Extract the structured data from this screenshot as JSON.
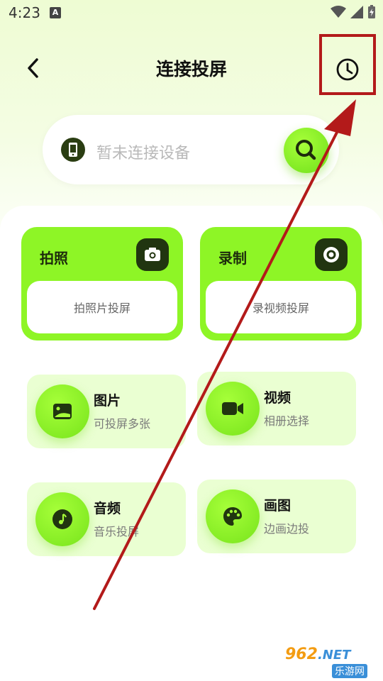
{
  "status": {
    "time": "4:23",
    "notification_letter": "A"
  },
  "header": {
    "title": "连接投屏"
  },
  "search": {
    "placeholder": "暂未连接设备"
  },
  "cards": {
    "photo": {
      "title": "拍照",
      "action": "拍照片投屏"
    },
    "record": {
      "title": "录制",
      "action": "录视频投屏"
    }
  },
  "tiles": [
    {
      "title": "图片",
      "subtitle": "可投屏多张",
      "icon": "image-icon"
    },
    {
      "title": "视频",
      "subtitle": "相册选择",
      "icon": "video-camera-icon"
    },
    {
      "title": "音频",
      "subtitle": "音乐投屏",
      "icon": "music-note-icon"
    },
    {
      "title": "画图",
      "subtitle": "边画边投",
      "icon": "palette-icon"
    }
  ],
  "watermark": {
    "brand": "962",
    "suffix": ".NET",
    "site": "乐游网"
  },
  "colors": {
    "accent": "#8ef526",
    "dark": "#213510",
    "annotation": "#b31a1a"
  }
}
